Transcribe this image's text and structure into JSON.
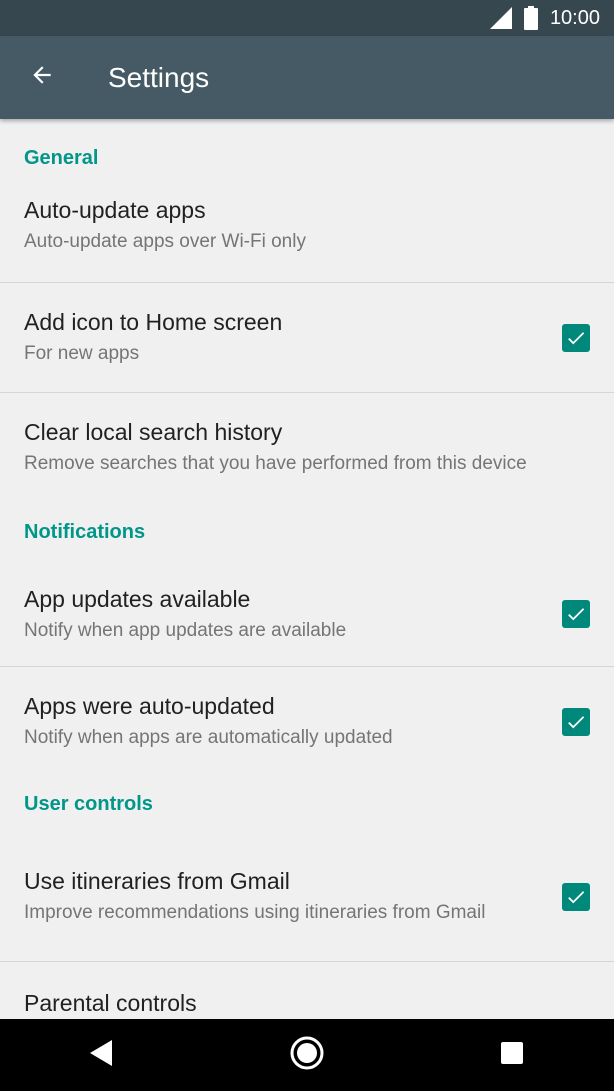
{
  "status_bar": {
    "time": "10:00"
  },
  "app_bar": {
    "title": "Settings"
  },
  "sections": {
    "general": {
      "header": "General",
      "auto_update": {
        "title": "Auto-update apps",
        "subtitle": "Auto-update apps over Wi-Fi only"
      },
      "add_icon": {
        "title": "Add icon to Home screen",
        "subtitle": "For new apps",
        "checked": true
      },
      "clear_history": {
        "title": "Clear local search history",
        "subtitle": "Remove searches that you have performed from this device"
      }
    },
    "notifications": {
      "header": "Notifications",
      "app_updates": {
        "title": "App updates available",
        "subtitle": "Notify when app updates are available",
        "checked": true
      },
      "auto_updated": {
        "title": "Apps were auto-updated",
        "subtitle": "Notify when apps are automatically updated",
        "checked": true
      }
    },
    "user_controls": {
      "header": "User controls",
      "itineraries": {
        "title": "Use itineraries from Gmail",
        "subtitle": "Improve recommendations using itineraries from Gmail",
        "checked": true
      },
      "parental": {
        "title": "Parental controls"
      }
    }
  },
  "colors": {
    "status_bar": "#37474f",
    "app_bar": "#455a64",
    "accent": "#009688",
    "checkbox": "#00897b",
    "background": "#f0f0f0"
  },
  "icons": {
    "back": "arrow-back-icon",
    "signal": "cell-signal-icon",
    "battery": "battery-icon",
    "nav_back": "triangle-back-icon",
    "nav_home": "circle-home-icon",
    "nav_recents": "square-recents-icon"
  }
}
